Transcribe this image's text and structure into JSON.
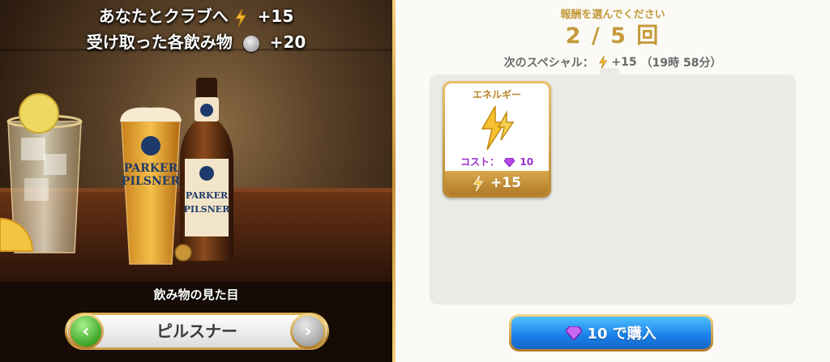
{
  "left": {
    "headline1": {
      "text": "あなたとクラブへ",
      "value": "+15",
      "icon": "energy-bolt-icon"
    },
    "headline2": {
      "text": "受け取った各飲み物",
      "value": "+20",
      "icon": "silver-coin-icon"
    },
    "drink_caption": "飲み物の見た目",
    "selector": {
      "label": "ピルスナー",
      "prev_icon": "chevron-left-icon",
      "next_icon": "chevron-right-icon"
    },
    "beer_branding": {
      "label": "PARKER PILSNER"
    }
  },
  "right": {
    "title": "報酬を選んでください",
    "count": "2 / 5 回",
    "next_special": {
      "prefix": "次のスペシャル：",
      "value": "+15",
      "time": "（19時 58分）",
      "icon": "energy-bolt-icon"
    },
    "cards": [
      {
        "title": "エネルギー",
        "cost_label": "コスト：",
        "cost_value": "10",
        "cost_icon": "gem-icon",
        "reward": "+15",
        "reward_icon": "energy-bolt-icon"
      }
    ],
    "buy_button": {
      "label": "10 で購入",
      "icon": "gem-icon"
    }
  },
  "colors": {
    "gold": "#c49a3c",
    "gem": "#9a2ec8",
    "buy_blue": "#1a7ee8",
    "green_arrow": "#3fa52a"
  }
}
